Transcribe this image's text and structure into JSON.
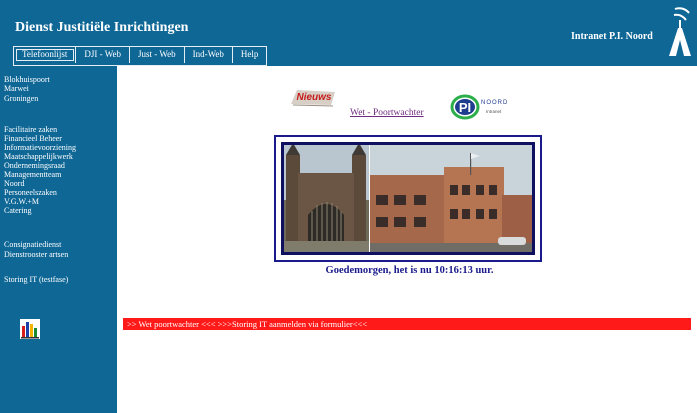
{
  "header": {
    "title": "Dienst Justitiële Inrichtingen",
    "intranet_title": "Intranet P.I. Noord",
    "nav": [
      "Telefoonlijst",
      "DJI - Web",
      "Just - Web",
      "Ind-Web",
      "Help"
    ],
    "logo_icon": "dji-logo-icon"
  },
  "sidebar": {
    "groups": [
      [
        "Blokhuispoort",
        "Marwei",
        "Groningen"
      ],
      [
        "Facilitaire zaken",
        "Financieel Beheer",
        "Informatievoorziening",
        "Maatschappelijkwerk",
        "Ondernemingsraad",
        "Managementteam",
        "Noord",
        "Personeelszaken",
        "V.G.W.+M",
        "Catering"
      ],
      [
        "Consignatiedienst",
        "Dienstrooster artsen"
      ],
      [
        "Storing IT (testfase)"
      ]
    ],
    "icon": "bar-chart-icon"
  },
  "main": {
    "news_label": "Nieuws",
    "wet_link": "Wet - Poortwachter",
    "pi_logo": {
      "letters": "PI",
      "line1": "NOORD",
      "line2": "Intranet"
    },
    "greeting": "Goedemorgen, het is nu 10:16:13 uur.",
    "marquee": ">> Wet poortwachter <<< >>>Storing IT aanmelden via formulier<<<"
  },
  "colors": {
    "header_bg": "#0f6796",
    "marquee_bg": "#ff1a1a",
    "greeting": "#1a1a8c",
    "link": "#6f2b80"
  }
}
